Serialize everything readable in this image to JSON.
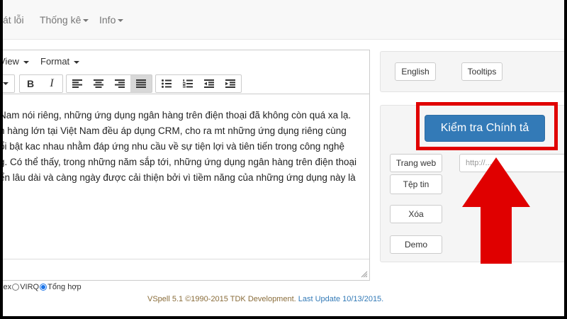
{
  "navbar": {
    "items": [
      {
        "label": "át lỗi",
        "has_caret": false
      },
      {
        "label": "Thống kê",
        "has_caret": true
      },
      {
        "label": "Info",
        "has_caret": true
      }
    ]
  },
  "editor": {
    "menu": [
      {
        "label": "View"
      },
      {
        "label": "Format"
      }
    ],
    "toolbar": {
      "bold_label": "B",
      "italic_label": "I",
      "buttons": [
        "dropdown-caret-icon",
        "bold-icon",
        "italic-icon",
        "align-left-icon",
        "align-center-icon",
        "align-right-icon",
        "align-justify-icon",
        "bullet-list-icon",
        "numbered-list-icon",
        "outdent-icon",
        "indent-icon"
      ],
      "active": "align-justify-icon"
    },
    "content_lines": [
      "Nam nói riêng, những ứng dụng ngân hàng trên điện thoại đã không còn quá xa lạ.",
      "n hàng lớn tại Việt Nam đều áp dụng CRM, cho ra mt những ứng dụng riêng cùng",
      "ổi bật kac nhau nhằm đáp ứng nhu cầu về sự tiện lợi và tiên tiến trong công nghệ",
      "g. Có thể thấy, trong những năm sắp tới, những ứng dụng ngân hàng trên điện thoại",
      "ển lâu dài và càng ngày được cải thiện bởi vì tiềm năng của những ứng dụng này là"
    ]
  },
  "input_modes": [
    {
      "label": "elex",
      "checked": false
    },
    {
      "label": "VIRQ",
      "checked": false
    },
    {
      "label": "Tổng hợp",
      "checked": true
    }
  ],
  "footer": {
    "text": "VSpell 5.1 ©1990-2015 TDK Development. ",
    "link": "Last Update 10/13/2015."
  },
  "language_panel": {
    "english_label": "English",
    "tooltips_label": "Tooltips"
  },
  "actions": {
    "check_spelling_label": "Kiểm tra Chính tả",
    "webpage_label": "Trang web",
    "file_label": "Tệp tin",
    "delete_label": "Xóa",
    "demo_label": "Demo",
    "url_placeholder": "http://..."
  },
  "colors": {
    "primary": "#337ab7",
    "highlight": "#e00000",
    "footer_text": "#8a6d3b",
    "link": "#337ab7"
  }
}
